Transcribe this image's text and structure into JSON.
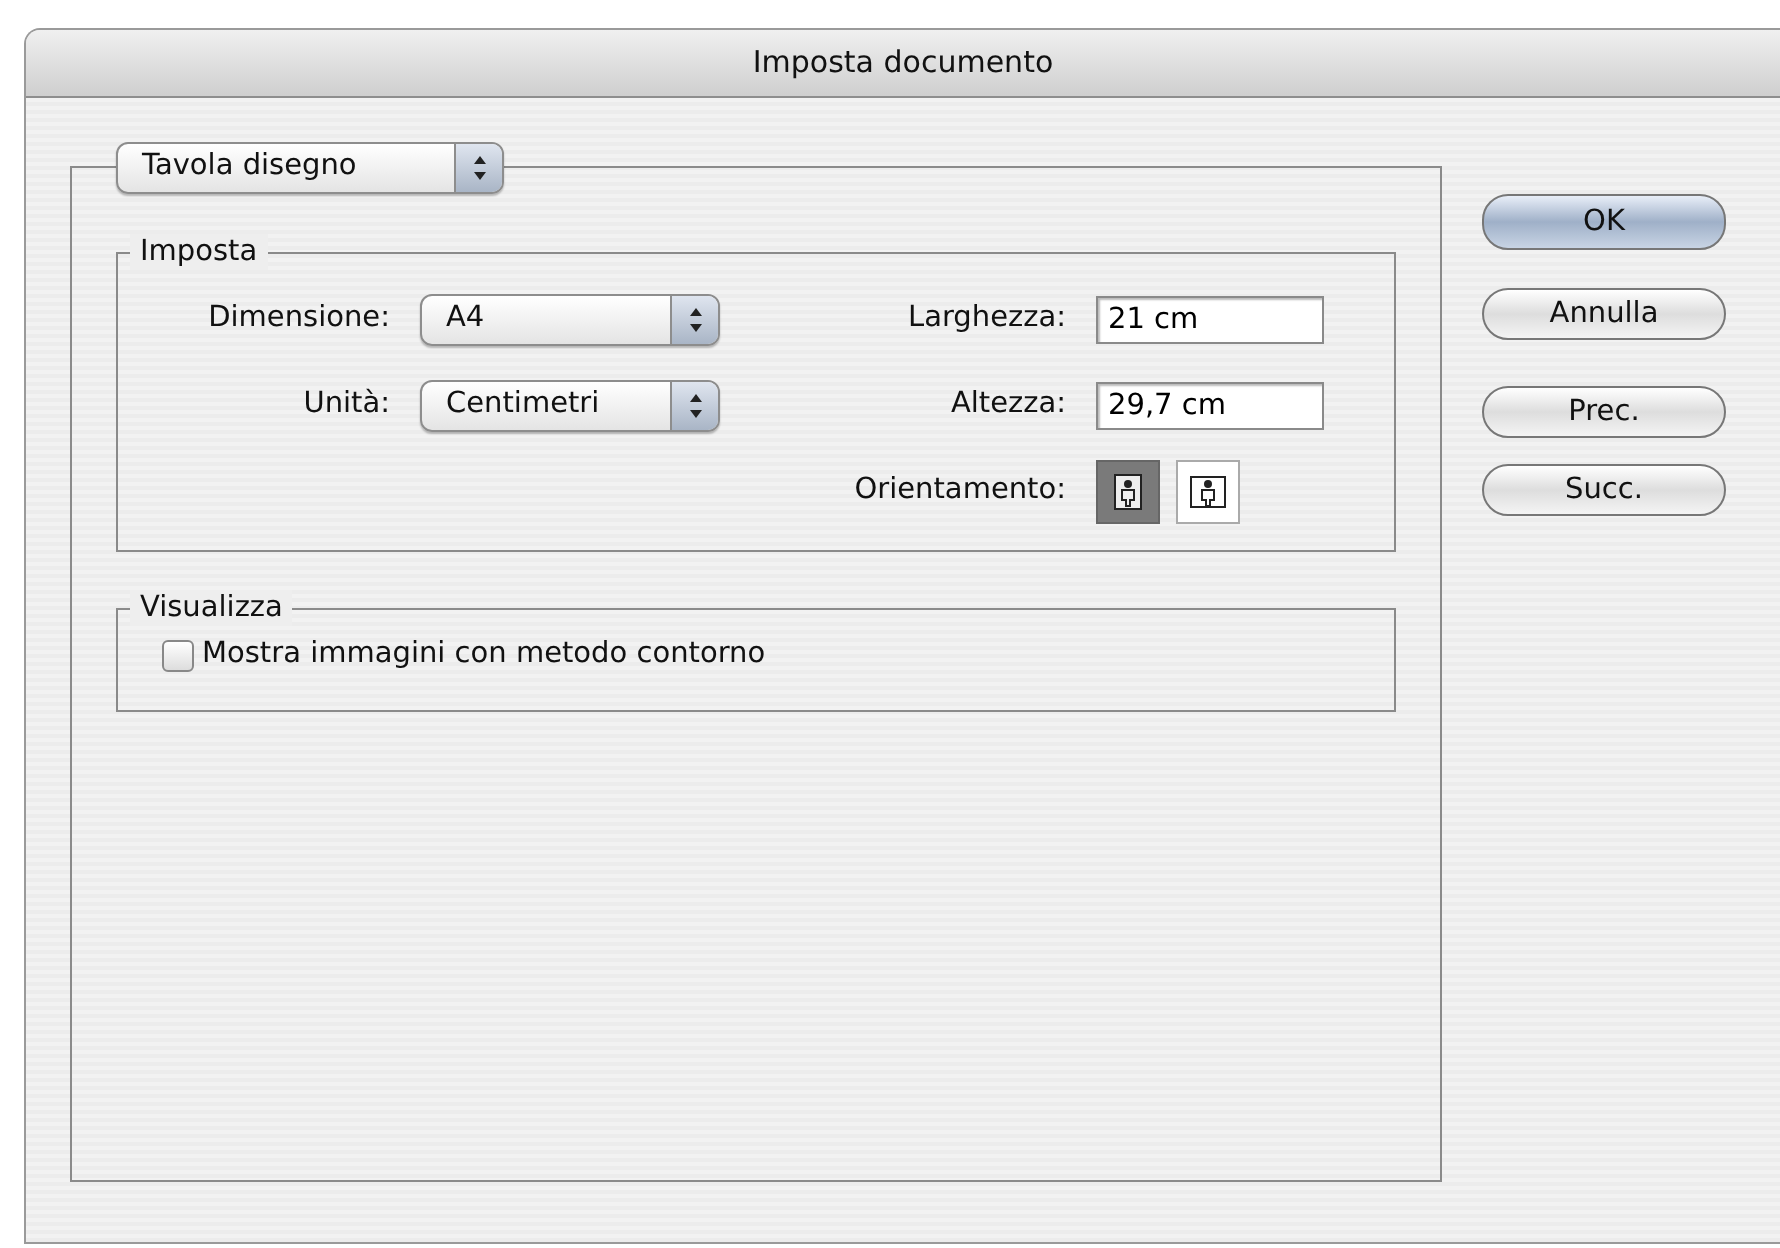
{
  "window": {
    "title": "Imposta documento"
  },
  "section_popup": {
    "value": "Tavola disegno"
  },
  "imposta": {
    "legend": "Imposta",
    "dimension": {
      "label": "Dimensione:",
      "value": "A4"
    },
    "units": {
      "label": "Unità:",
      "value": "Centimetri"
    },
    "width": {
      "label": "Larghezza:",
      "value": "21 cm"
    },
    "height": {
      "label": "Altezza:",
      "value": "29,7 cm"
    },
    "orientation": {
      "label": "Orientamento:",
      "options": [
        {
          "kind": "portrait",
          "selected": true
        },
        {
          "kind": "landscape",
          "selected": false
        }
      ]
    }
  },
  "visualizza": {
    "legend": "Visualizza",
    "checkbox": {
      "label": "Mostra immagini con metodo contorno",
      "checked": false
    }
  },
  "buttons": [
    {
      "label": "OK",
      "default": true
    },
    {
      "label": "Annulla",
      "default": false
    },
    {
      "label": "Prec.",
      "default": false
    },
    {
      "label": "Succ.",
      "default": false
    }
  ]
}
